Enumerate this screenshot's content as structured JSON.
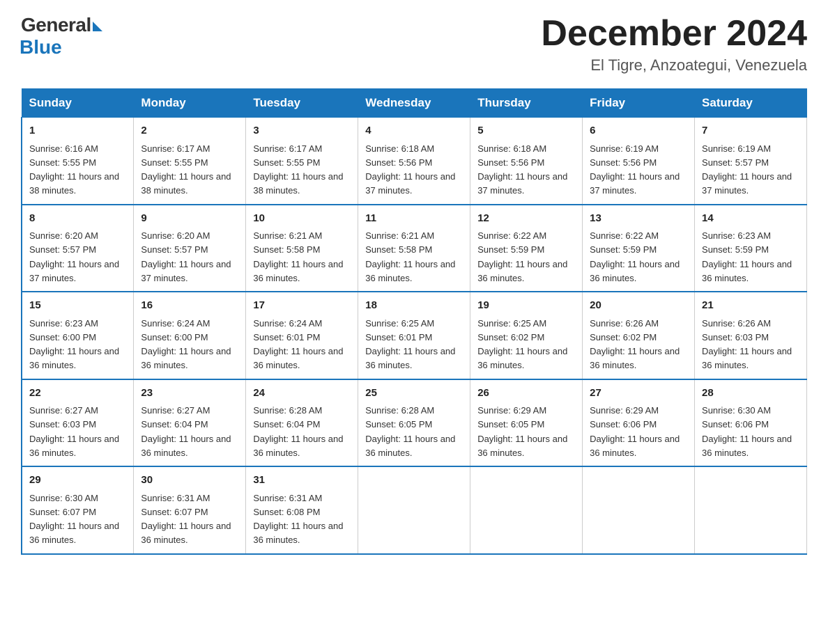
{
  "logo": {
    "general": "General",
    "blue": "Blue"
  },
  "title": "December 2024",
  "location": "El Tigre, Anzoategui, Venezuela",
  "days_of_week": [
    "Sunday",
    "Monday",
    "Tuesday",
    "Wednesday",
    "Thursday",
    "Friday",
    "Saturday"
  ],
  "weeks": [
    [
      {
        "day": "1",
        "sunrise": "6:16 AM",
        "sunset": "5:55 PM",
        "daylight": "11 hours and 38 minutes."
      },
      {
        "day": "2",
        "sunrise": "6:17 AM",
        "sunset": "5:55 PM",
        "daylight": "11 hours and 38 minutes."
      },
      {
        "day": "3",
        "sunrise": "6:17 AM",
        "sunset": "5:55 PM",
        "daylight": "11 hours and 38 minutes."
      },
      {
        "day": "4",
        "sunrise": "6:18 AM",
        "sunset": "5:56 PM",
        "daylight": "11 hours and 37 minutes."
      },
      {
        "day": "5",
        "sunrise": "6:18 AM",
        "sunset": "5:56 PM",
        "daylight": "11 hours and 37 minutes."
      },
      {
        "day": "6",
        "sunrise": "6:19 AM",
        "sunset": "5:56 PM",
        "daylight": "11 hours and 37 minutes."
      },
      {
        "day": "7",
        "sunrise": "6:19 AM",
        "sunset": "5:57 PM",
        "daylight": "11 hours and 37 minutes."
      }
    ],
    [
      {
        "day": "8",
        "sunrise": "6:20 AM",
        "sunset": "5:57 PM",
        "daylight": "11 hours and 37 minutes."
      },
      {
        "day": "9",
        "sunrise": "6:20 AM",
        "sunset": "5:57 PM",
        "daylight": "11 hours and 37 minutes."
      },
      {
        "day": "10",
        "sunrise": "6:21 AM",
        "sunset": "5:58 PM",
        "daylight": "11 hours and 36 minutes."
      },
      {
        "day": "11",
        "sunrise": "6:21 AM",
        "sunset": "5:58 PM",
        "daylight": "11 hours and 36 minutes."
      },
      {
        "day": "12",
        "sunrise": "6:22 AM",
        "sunset": "5:59 PM",
        "daylight": "11 hours and 36 minutes."
      },
      {
        "day": "13",
        "sunrise": "6:22 AM",
        "sunset": "5:59 PM",
        "daylight": "11 hours and 36 minutes."
      },
      {
        "day": "14",
        "sunrise": "6:23 AM",
        "sunset": "5:59 PM",
        "daylight": "11 hours and 36 minutes."
      }
    ],
    [
      {
        "day": "15",
        "sunrise": "6:23 AM",
        "sunset": "6:00 PM",
        "daylight": "11 hours and 36 minutes."
      },
      {
        "day": "16",
        "sunrise": "6:24 AM",
        "sunset": "6:00 PM",
        "daylight": "11 hours and 36 minutes."
      },
      {
        "day": "17",
        "sunrise": "6:24 AM",
        "sunset": "6:01 PM",
        "daylight": "11 hours and 36 minutes."
      },
      {
        "day": "18",
        "sunrise": "6:25 AM",
        "sunset": "6:01 PM",
        "daylight": "11 hours and 36 minutes."
      },
      {
        "day": "19",
        "sunrise": "6:25 AM",
        "sunset": "6:02 PM",
        "daylight": "11 hours and 36 minutes."
      },
      {
        "day": "20",
        "sunrise": "6:26 AM",
        "sunset": "6:02 PM",
        "daylight": "11 hours and 36 minutes."
      },
      {
        "day": "21",
        "sunrise": "6:26 AM",
        "sunset": "6:03 PM",
        "daylight": "11 hours and 36 minutes."
      }
    ],
    [
      {
        "day": "22",
        "sunrise": "6:27 AM",
        "sunset": "6:03 PM",
        "daylight": "11 hours and 36 minutes."
      },
      {
        "day": "23",
        "sunrise": "6:27 AM",
        "sunset": "6:04 PM",
        "daylight": "11 hours and 36 minutes."
      },
      {
        "day": "24",
        "sunrise": "6:28 AM",
        "sunset": "6:04 PM",
        "daylight": "11 hours and 36 minutes."
      },
      {
        "day": "25",
        "sunrise": "6:28 AM",
        "sunset": "6:05 PM",
        "daylight": "11 hours and 36 minutes."
      },
      {
        "day": "26",
        "sunrise": "6:29 AM",
        "sunset": "6:05 PM",
        "daylight": "11 hours and 36 minutes."
      },
      {
        "day": "27",
        "sunrise": "6:29 AM",
        "sunset": "6:06 PM",
        "daylight": "11 hours and 36 minutes."
      },
      {
        "day": "28",
        "sunrise": "6:30 AM",
        "sunset": "6:06 PM",
        "daylight": "11 hours and 36 minutes."
      }
    ],
    [
      {
        "day": "29",
        "sunrise": "6:30 AM",
        "sunset": "6:07 PM",
        "daylight": "11 hours and 36 minutes."
      },
      {
        "day": "30",
        "sunrise": "6:31 AM",
        "sunset": "6:07 PM",
        "daylight": "11 hours and 36 minutes."
      },
      {
        "day": "31",
        "sunrise": "6:31 AM",
        "sunset": "6:08 PM",
        "daylight": "11 hours and 36 minutes."
      },
      null,
      null,
      null,
      null
    ]
  ]
}
